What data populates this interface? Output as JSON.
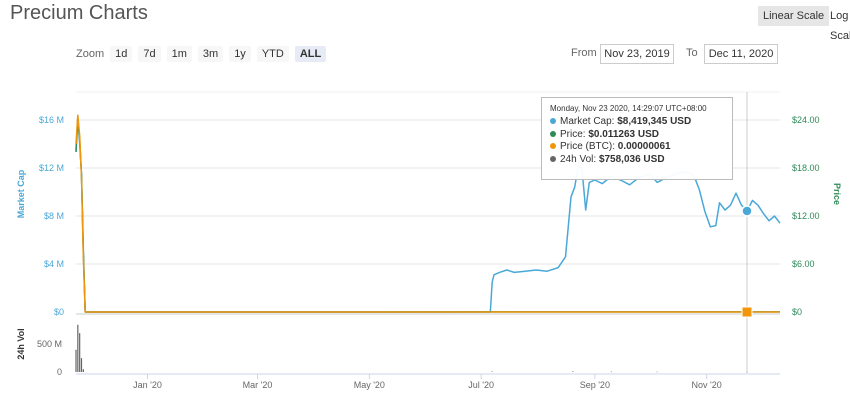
{
  "header": {
    "title": "Precium Charts",
    "scale_linear": "Linear Scale",
    "scale_log": "Log Scale"
  },
  "zoom": {
    "label": "Zoom",
    "buttons": [
      "1d",
      "7d",
      "1m",
      "3m",
      "1y",
      "YTD",
      "ALL"
    ],
    "active": "ALL"
  },
  "range": {
    "from_label": "From",
    "from_value": "Nov 23, 2019",
    "to_label": "To",
    "to_value": "Dec 11, 2020"
  },
  "tooltip": {
    "date": "Monday, Nov 23 2020, 14:29:07 UTC+08:00",
    "rows": [
      {
        "label": "Market Cap:",
        "value": "$8,419,345 USD",
        "color": "#4aa8d8"
      },
      {
        "label": "Price:",
        "value": "$0.011263 USD",
        "color": "#2e8b57"
      },
      {
        "label": "Price (BTC):",
        "value": "0.00000061",
        "color": "#f0960a"
      },
      {
        "label": "24h Vol:",
        "value": "$758,036 USD",
        "color": "#666666"
      }
    ]
  },
  "colors": {
    "market_cap": "#4aa8d8",
    "price": "#2e8b57",
    "price_btc": "#f0960a",
    "volume": "#666666"
  },
  "chart_data": {
    "type": "line",
    "title": "Precium Charts",
    "x_range": [
      "2019-11-23",
      "2020-12-11"
    ],
    "x_ticks": [
      "Jan '20",
      "Mar '20",
      "May '20",
      "Jul '20",
      "Sep '20",
      "Nov '20"
    ],
    "left_axis": {
      "label": "Market Cap",
      "ticks": [
        "$0",
        "$4 M",
        "$8 M",
        "$12 M",
        "$16 M"
      ],
      "range": [
        0,
        16000000
      ]
    },
    "right_axis": {
      "label": "Price",
      "ticks": [
        "$0",
        "$6.00",
        "$12.00",
        "$18.00",
        "$24.00"
      ],
      "range": [
        0,
        24
      ]
    },
    "volume_axis": {
      "label": "24h Vol",
      "ticks": [
        "0",
        "500 M"
      ],
      "range": [
        0,
        900000000
      ]
    },
    "series": [
      {
        "name": "Market Cap",
        "axis": "left",
        "points": [
          [
            "2019-11-23",
            13500000
          ],
          [
            "2019-11-24",
            16300000
          ],
          [
            "2019-11-25",
            14000000
          ],
          [
            "2019-11-26",
            11500000
          ],
          [
            "2019-11-27",
            5000000
          ],
          [
            "2019-11-28",
            0
          ],
          [
            "2020-07-06",
            0
          ],
          [
            "2020-07-07",
            2500000
          ],
          [
            "2020-07-08",
            3100000
          ],
          [
            "2020-07-11",
            3300000
          ],
          [
            "2020-07-15",
            3500000
          ],
          [
            "2020-07-19",
            3300000
          ],
          [
            "2020-07-25",
            3400000
          ],
          [
            "2020-07-31",
            3500000
          ],
          [
            "2020-08-06",
            3400000
          ],
          [
            "2020-08-12",
            3700000
          ],
          [
            "2020-08-16",
            4600000
          ],
          [
            "2020-08-19",
            9600000
          ],
          [
            "2020-08-21",
            10400000
          ],
          [
            "2020-08-23",
            12200000
          ],
          [
            "2020-08-25",
            11900000
          ],
          [
            "2020-08-27",
            8500000
          ],
          [
            "2020-08-29",
            10800000
          ],
          [
            "2020-09-01",
            11000000
          ],
          [
            "2020-09-05",
            10700000
          ],
          [
            "2020-09-10",
            11300000
          ],
          [
            "2020-09-15",
            11000000
          ],
          [
            "2020-09-20",
            10600000
          ],
          [
            "2020-09-25",
            11200000
          ],
          [
            "2020-10-01",
            11500000
          ],
          [
            "2020-10-05",
            10800000
          ],
          [
            "2020-10-10",
            11200000
          ],
          [
            "2020-10-15",
            11500000
          ],
          [
            "2020-10-20",
            11700000
          ],
          [
            "2020-10-25",
            11400000
          ],
          [
            "2020-10-28",
            10200000
          ],
          [
            "2020-10-31",
            8400000
          ],
          [
            "2020-11-03",
            7100000
          ],
          [
            "2020-11-06",
            7200000
          ],
          [
            "2020-11-08",
            9100000
          ],
          [
            "2020-11-11",
            8500000
          ],
          [
            "2020-11-14",
            8900000
          ],
          [
            "2020-11-17",
            9900000
          ],
          [
            "2020-11-20",
            8900000
          ],
          [
            "2020-11-23",
            8419345
          ],
          [
            "2020-11-26",
            9300000
          ],
          [
            "2020-11-29",
            8900000
          ],
          [
            "2020-12-02",
            8200000
          ],
          [
            "2020-12-05",
            7600000
          ],
          [
            "2020-12-08",
            8000000
          ],
          [
            "2020-12-11",
            7400000
          ]
        ]
      },
      {
        "name": "Price",
        "axis": "right",
        "points": [
          [
            "2019-11-23",
            20.0
          ],
          [
            "2019-11-24",
            24.0
          ],
          [
            "2019-11-25",
            21.5
          ],
          [
            "2019-11-26",
            17.2
          ],
          [
            "2019-11-27",
            8.0
          ],
          [
            "2019-11-28",
            0.0
          ],
          [
            "2020-11-23",
            0.011263
          ],
          [
            "2020-12-11",
            0.011
          ]
        ]
      },
      {
        "name": "Price (BTC)",
        "axis": "right",
        "points": [
          [
            "2019-11-23",
            21.0
          ],
          [
            "2019-11-24",
            24.6
          ],
          [
            "2019-11-25",
            22.0
          ],
          [
            "2019-11-26",
            16.8
          ],
          [
            "2019-11-27",
            7.0
          ],
          [
            "2019-11-28",
            0.0
          ],
          [
            "2020-11-23",
            6.1e-07
          ],
          [
            "2020-12-11",
            0.0
          ]
        ]
      },
      {
        "name": "24h Vol",
        "axis": "volume",
        "type": "bar",
        "points": [
          [
            "2019-11-23",
            400000000
          ],
          [
            "2019-11-24",
            850000000
          ],
          [
            "2019-11-25",
            700000000
          ],
          [
            "2019-11-26",
            250000000
          ],
          [
            "2019-11-27",
            50000000
          ],
          [
            "2020-07-07",
            10000000
          ],
          [
            "2020-08-20",
            12000000
          ],
          [
            "2020-09-10",
            8000000
          ],
          [
            "2020-10-05",
            6000000
          ],
          [
            "2020-11-23",
            758036
          ]
        ]
      }
    ],
    "grid": true
  }
}
